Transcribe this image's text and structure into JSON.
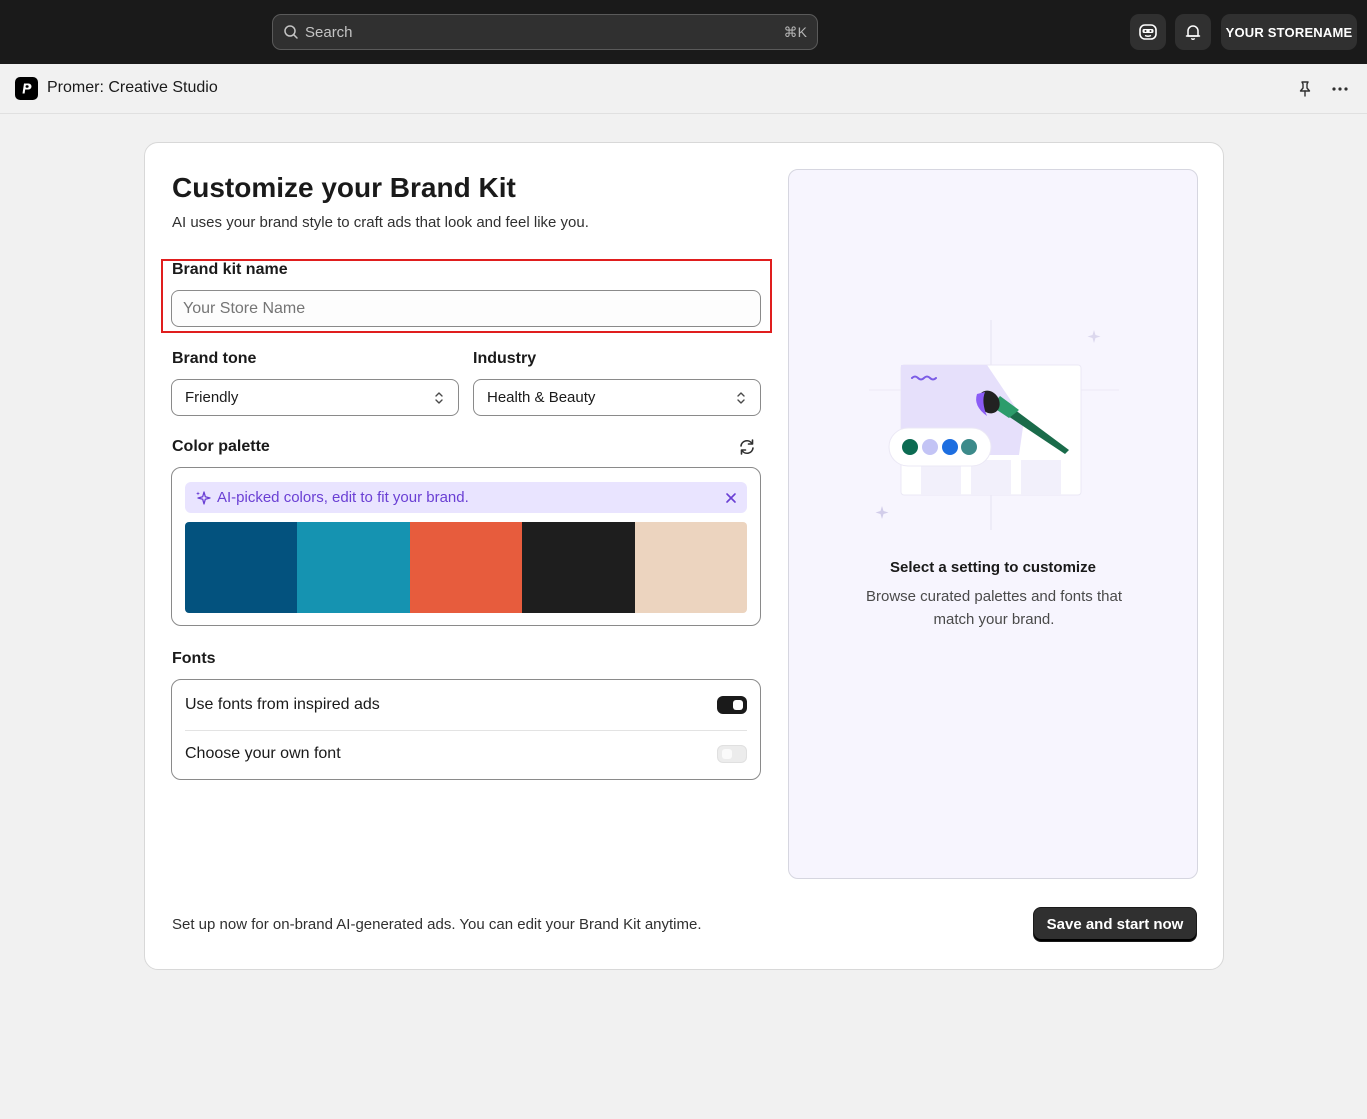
{
  "topbar": {
    "search_placeholder": "Search",
    "search_shortcut": "⌘K",
    "store_label": "YOUR STORENAME",
    "icons": [
      "search-icon",
      "store-mascot-icon",
      "bell-icon"
    ]
  },
  "app": {
    "title": "Promer: Creative Studio",
    "icons": [
      "promer-logo-icon",
      "pin-icon",
      "more-horizontal-icon"
    ]
  },
  "form": {
    "heading": "Customize your Brand Kit",
    "subtitle": "AI uses your brand style to craft ads that look and feel like you.",
    "brand_kit_name": {
      "label": "Brand kit name",
      "value": "",
      "placeholder": "Your Store Name"
    },
    "brand_tone": {
      "label": "Brand tone",
      "value": "Friendly"
    },
    "industry": {
      "label": "Industry",
      "value": "Health & Beauty"
    },
    "color_palette": {
      "label": "Color palette",
      "banner_text": "AI-picked colors, edit to fit your brand.",
      "swatches": [
        "#03527e",
        "#1593b1",
        "#e75c3d",
        "#1e1e1e",
        "#ecd4bf"
      ]
    },
    "fonts": {
      "label": "Fonts",
      "options": [
        {
          "label": "Use fonts from inspired ads",
          "enabled": true
        },
        {
          "label": "Choose your own font",
          "enabled": false
        }
      ]
    },
    "footer_text": "Set up now for on-brand AI-generated ads. You can edit your Brand Kit anytime.",
    "save_label": "Save and start now"
  },
  "preview": {
    "title": "Select a setting to customize",
    "description": "Browse curated palettes and fonts that match your brand.",
    "illustration_dots": [
      "#0c6b52",
      "#c3c4f5",
      "#1d6ee0",
      "#3c8a8a"
    ]
  },
  "colors": {
    "highlight_border": "#e01e1e",
    "accent_purple": "#6a3fd4"
  }
}
